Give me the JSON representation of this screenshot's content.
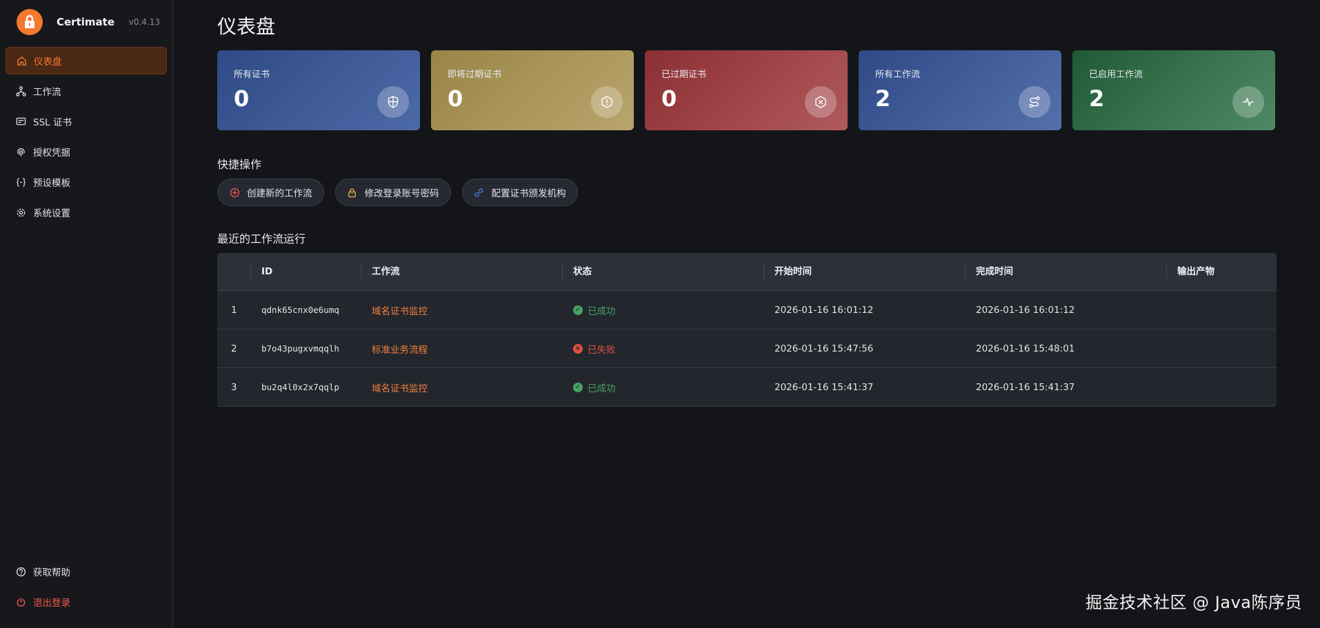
{
  "sidebar": {
    "brand": {
      "name": "Certimate",
      "version": "v0.4.13"
    },
    "items": [
      {
        "label": "仪表盘",
        "icon": "home-icon",
        "active": true
      },
      {
        "label": "工作流",
        "icon": "workflow-icon"
      },
      {
        "label": "SSL 证书",
        "icon": "certificate-icon"
      },
      {
        "label": "授权凭据",
        "icon": "fingerprint-icon"
      },
      {
        "label": "预设模板",
        "icon": "braces-icon"
      },
      {
        "label": "系统设置",
        "icon": "gear-icon"
      }
    ],
    "bottom": [
      {
        "label": "获取帮助",
        "icon": "help-icon"
      },
      {
        "label": "退出登录",
        "icon": "power-icon"
      }
    ]
  },
  "main": {
    "title": "仪表盘",
    "stats": [
      {
        "label": "所有证书",
        "value": "0",
        "icon": "shield-icon",
        "color": "#3e5b98"
      },
      {
        "label": "即将过期证书",
        "value": "0",
        "icon": "warning-hex-icon",
        "color": "#a9955a"
      },
      {
        "label": "已过期证书",
        "value": "0",
        "icon": "x-hex-icon",
        "color": "#9c4446"
      },
      {
        "label": "所有工作流",
        "value": "2",
        "icon": "route-icon",
        "color": "#405d9a"
      },
      {
        "label": "已启用工作流",
        "value": "2",
        "icon": "activity-icon",
        "color": "#367148"
      }
    ],
    "quick": {
      "title": "快捷操作",
      "actions": [
        {
          "label": "创建新的工作流",
          "icon": "plus-circle-icon"
        },
        {
          "label": "修改登录账号密码",
          "icon": "lock-icon"
        },
        {
          "label": "配置证书颁发机构",
          "icon": "link-icon"
        }
      ]
    },
    "recent": {
      "title": "最近的工作流运行",
      "columns": [
        "ID",
        "工作流",
        "状态",
        "开始时间",
        "完成时间",
        "输出产物"
      ],
      "rows": [
        {
          "index": "1",
          "id": "qdnk65cnx0e6umq",
          "workflow": "域名证书监控",
          "status": "已成功",
          "status_type": "success",
          "start": "2026-01-16 16:01:12",
          "end": "2026-01-16 16:01:12",
          "output": ""
        },
        {
          "index": "2",
          "id": "b7o43pugxvmqqlh",
          "workflow": "标准业务流程",
          "status": "已失败",
          "status_type": "failed",
          "start": "2026-01-16 15:47:56",
          "end": "2026-01-16 15:48:01",
          "output": ""
        },
        {
          "index": "3",
          "id": "bu2q4l0x2x7qqlp",
          "workflow": "域名证书监控",
          "status": "已成功",
          "status_type": "success",
          "start": "2026-01-16 15:41:37",
          "end": "2026-01-16 15:41:37",
          "output": ""
        }
      ]
    }
  },
  "watermark": "掘金技术社区 @ Java陈序员",
  "colors": {
    "accent": "#f4782f",
    "success": "#47a264",
    "danger": "#e0503f"
  }
}
